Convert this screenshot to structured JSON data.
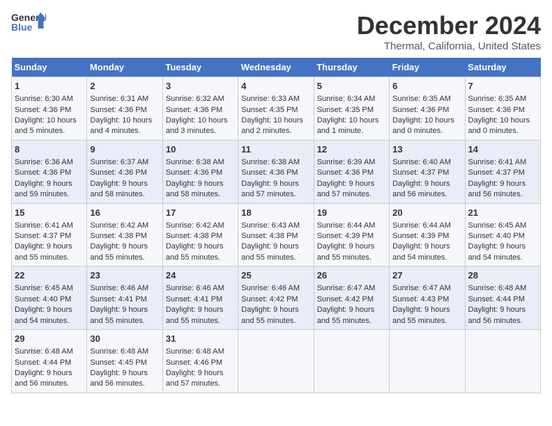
{
  "logo": {
    "line1": "General",
    "line2": "Blue"
  },
  "title": "December 2024",
  "subtitle": "Thermal, California, United States",
  "days_of_week": [
    "Sunday",
    "Monday",
    "Tuesday",
    "Wednesday",
    "Thursday",
    "Friday",
    "Saturday"
  ],
  "weeks": [
    [
      {
        "day": "1",
        "sunrise": "6:30 AM",
        "sunset": "4:36 PM",
        "daylight": "10 hours and 5 minutes."
      },
      {
        "day": "2",
        "sunrise": "6:31 AM",
        "sunset": "4:36 PM",
        "daylight": "10 hours and 4 minutes."
      },
      {
        "day": "3",
        "sunrise": "6:32 AM",
        "sunset": "4:36 PM",
        "daylight": "10 hours and 3 minutes."
      },
      {
        "day": "4",
        "sunrise": "6:33 AM",
        "sunset": "4:35 PM",
        "daylight": "10 hours and 2 minutes."
      },
      {
        "day": "5",
        "sunrise": "6:34 AM",
        "sunset": "4:35 PM",
        "daylight": "10 hours and 1 minute."
      },
      {
        "day": "6",
        "sunrise": "6:35 AM",
        "sunset": "4:36 PM",
        "daylight": "10 hours and 0 minutes."
      },
      {
        "day": "7",
        "sunrise": "6:35 AM",
        "sunset": "4:36 PM",
        "daylight": "10 hours and 0 minutes."
      }
    ],
    [
      {
        "day": "8",
        "sunrise": "6:36 AM",
        "sunset": "4:36 PM",
        "daylight": "9 hours and 59 minutes."
      },
      {
        "day": "9",
        "sunrise": "6:37 AM",
        "sunset": "4:36 PM",
        "daylight": "9 hours and 58 minutes."
      },
      {
        "day": "10",
        "sunrise": "6:38 AM",
        "sunset": "4:36 PM",
        "daylight": "9 hours and 58 minutes."
      },
      {
        "day": "11",
        "sunrise": "6:38 AM",
        "sunset": "4:36 PM",
        "daylight": "9 hours and 57 minutes."
      },
      {
        "day": "12",
        "sunrise": "6:39 AM",
        "sunset": "4:36 PM",
        "daylight": "9 hours and 57 minutes."
      },
      {
        "day": "13",
        "sunrise": "6:40 AM",
        "sunset": "4:37 PM",
        "daylight": "9 hours and 56 minutes."
      },
      {
        "day": "14",
        "sunrise": "6:41 AM",
        "sunset": "4:37 PM",
        "daylight": "9 hours and 56 minutes."
      }
    ],
    [
      {
        "day": "15",
        "sunrise": "6:41 AM",
        "sunset": "4:37 PM",
        "daylight": "9 hours and 55 minutes."
      },
      {
        "day": "16",
        "sunrise": "6:42 AM",
        "sunset": "4:38 PM",
        "daylight": "9 hours and 55 minutes."
      },
      {
        "day": "17",
        "sunrise": "6:42 AM",
        "sunset": "4:38 PM",
        "daylight": "9 hours and 55 minutes."
      },
      {
        "day": "18",
        "sunrise": "6:43 AM",
        "sunset": "4:38 PM",
        "daylight": "9 hours and 55 minutes."
      },
      {
        "day": "19",
        "sunrise": "6:44 AM",
        "sunset": "4:39 PM",
        "daylight": "9 hours and 55 minutes."
      },
      {
        "day": "20",
        "sunrise": "6:44 AM",
        "sunset": "4:39 PM",
        "daylight": "9 hours and 54 minutes."
      },
      {
        "day": "21",
        "sunrise": "6:45 AM",
        "sunset": "4:40 PM",
        "daylight": "9 hours and 54 minutes."
      }
    ],
    [
      {
        "day": "22",
        "sunrise": "6:45 AM",
        "sunset": "4:40 PM",
        "daylight": "9 hours and 54 minutes."
      },
      {
        "day": "23",
        "sunrise": "6:46 AM",
        "sunset": "4:41 PM",
        "daylight": "9 hours and 55 minutes."
      },
      {
        "day": "24",
        "sunrise": "6:46 AM",
        "sunset": "4:41 PM",
        "daylight": "9 hours and 55 minutes."
      },
      {
        "day": "25",
        "sunrise": "6:46 AM",
        "sunset": "4:42 PM",
        "daylight": "9 hours and 55 minutes."
      },
      {
        "day": "26",
        "sunrise": "6:47 AM",
        "sunset": "4:42 PM",
        "daylight": "9 hours and 55 minutes."
      },
      {
        "day": "27",
        "sunrise": "6:47 AM",
        "sunset": "4:43 PM",
        "daylight": "9 hours and 55 minutes."
      },
      {
        "day": "28",
        "sunrise": "6:48 AM",
        "sunset": "4:44 PM",
        "daylight": "9 hours and 56 minutes."
      }
    ],
    [
      {
        "day": "29",
        "sunrise": "6:48 AM",
        "sunset": "4:44 PM",
        "daylight": "9 hours and 56 minutes."
      },
      {
        "day": "30",
        "sunrise": "6:48 AM",
        "sunset": "4:45 PM",
        "daylight": "9 hours and 56 minutes."
      },
      {
        "day": "31",
        "sunrise": "6:48 AM",
        "sunset": "4:46 PM",
        "daylight": "9 hours and 57 minutes."
      },
      null,
      null,
      null,
      null
    ]
  ]
}
